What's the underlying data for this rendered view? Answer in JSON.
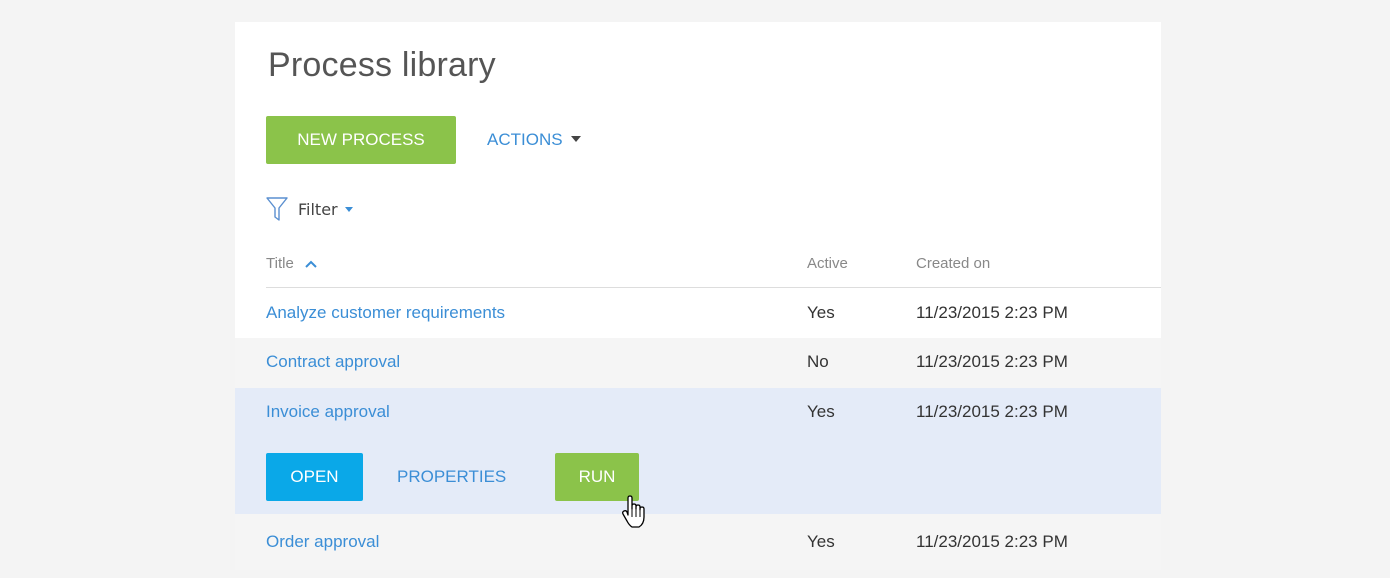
{
  "page": {
    "title": "Process library"
  },
  "toolbar": {
    "new_process_label": "NEW PROCESS",
    "actions_label": "ACTIONS"
  },
  "filter": {
    "label": "Filter"
  },
  "table": {
    "columns": [
      "Title",
      "Active",
      "Created on"
    ],
    "sorted_column": "Title",
    "sort_direction": "ascending",
    "rows": [
      {
        "title": "Analyze customer requirements",
        "active": "Yes",
        "created_on": "11/23/2015 2:23 PM"
      },
      {
        "title": "Contract approval",
        "active": "No",
        "created_on": "11/23/2015 2:23 PM"
      },
      {
        "title": "Invoice approval",
        "active": "Yes",
        "created_on": "11/23/2015 2:23 PM"
      },
      {
        "title": "Order approval",
        "active": "Yes",
        "created_on": "11/23/2015 2:23 PM"
      }
    ],
    "selected_row_index": 2,
    "row_actions": {
      "open_label": "OPEN",
      "properties_label": "PROPERTIES",
      "run_label": "RUN"
    }
  },
  "colors": {
    "primary_green": "#8bc34a",
    "open_blue": "#0aa8e8",
    "link_blue": "#3b8ed6",
    "selected_row_bg": "#e4ebf8"
  },
  "icons": {
    "filter": "filter-funnel-icon",
    "sort": "chevron-up-icon",
    "dropdown": "caret-down-icon",
    "cursor": "hand-pointer-icon"
  }
}
